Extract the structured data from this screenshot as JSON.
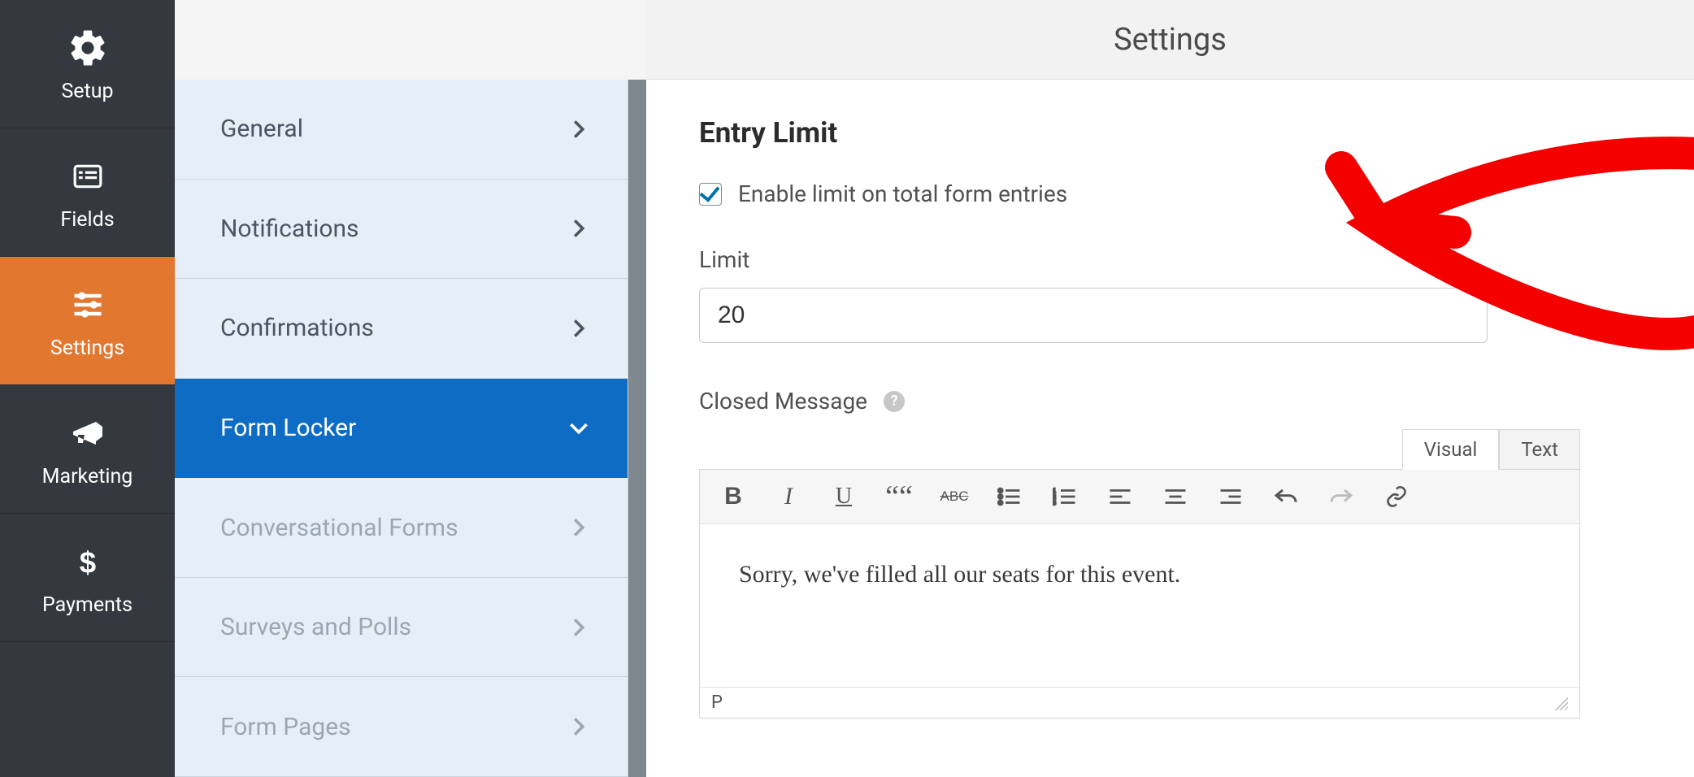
{
  "header": {
    "title": "Settings"
  },
  "nav": {
    "items": [
      {
        "label": "Setup"
      },
      {
        "label": "Fields"
      },
      {
        "label": "Settings"
      },
      {
        "label": "Marketing"
      },
      {
        "label": "Payments"
      }
    ]
  },
  "submenu": {
    "items": [
      {
        "label": "General"
      },
      {
        "label": "Notifications"
      },
      {
        "label": "Confirmations"
      },
      {
        "label": "Form Locker"
      },
      {
        "label": "Conversational Forms"
      },
      {
        "label": "Surveys and Polls"
      },
      {
        "label": "Form Pages"
      }
    ]
  },
  "section": {
    "heading": "Entry Limit",
    "checkbox_label": "Enable limit on total form entries",
    "checkbox_checked": true,
    "limit_label": "Limit",
    "limit_value": "20",
    "closed_message_label": "Closed Message"
  },
  "editor": {
    "tabs": {
      "visual": "Visual",
      "text": "Text",
      "active": "visual"
    },
    "content": "Sorry, we've filled all our seats for this event.",
    "status_path": "P",
    "toolbar": {
      "bold": "B",
      "italic": "I",
      "underline": "U",
      "blockquote": "““",
      "strikethrough": "ABC"
    }
  }
}
